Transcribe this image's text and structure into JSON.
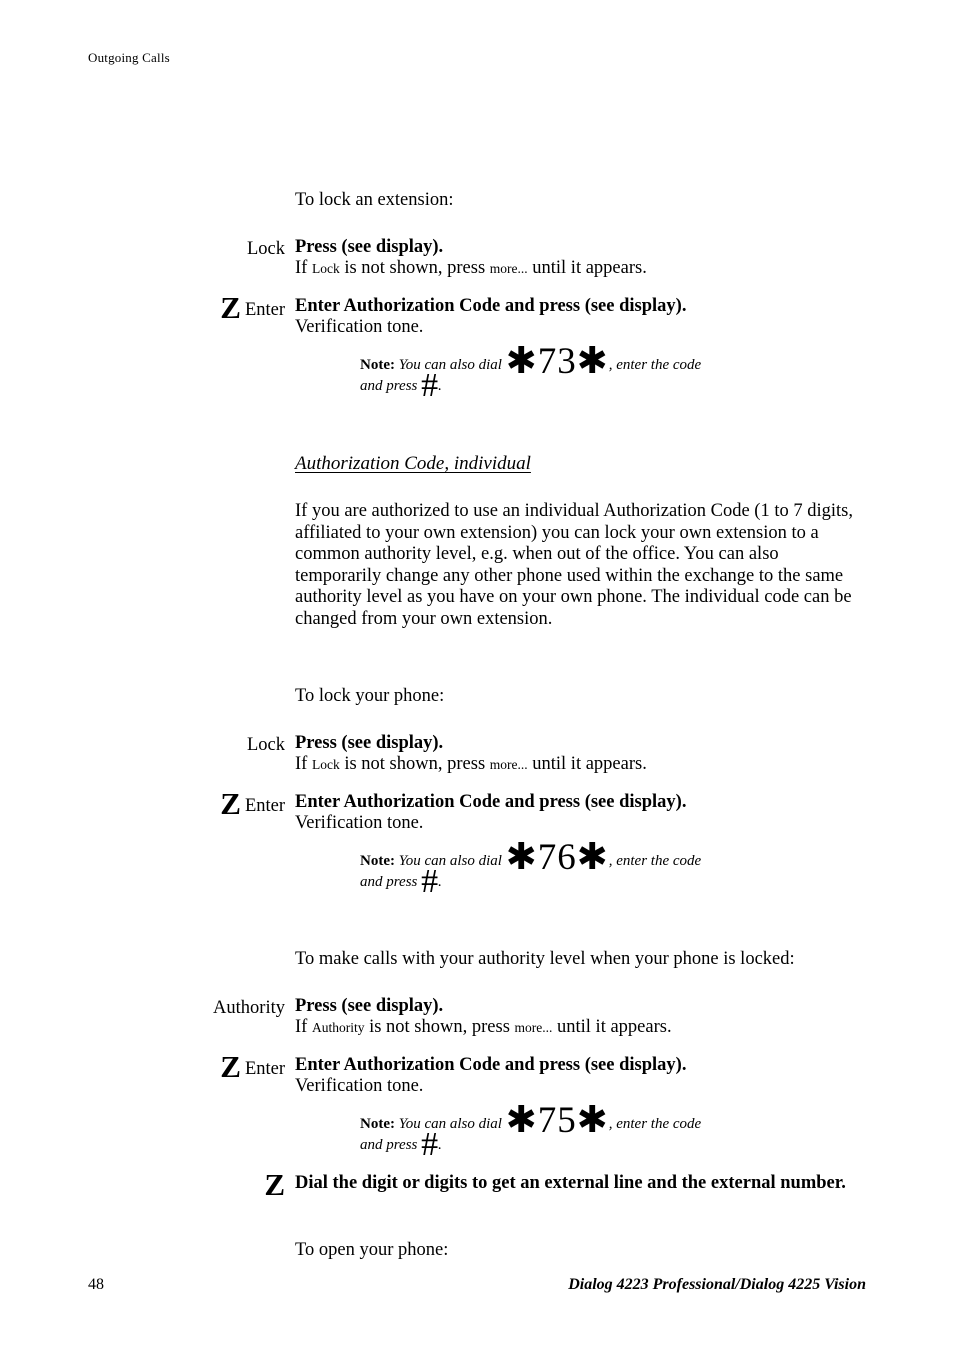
{
  "header": {
    "running_head": "Outgoing Calls"
  },
  "sections": [
    {
      "lead": "To lock an extension:",
      "steps": [
        {
          "key_glyph": "",
          "key_label": "Lock",
          "title": "Press (see display).",
          "sub_prefix": "If ",
          "sub_softkey1": "Lock",
          "sub_middle": " is not shown, press ",
          "sub_softkey2": "more...",
          "sub_suffix": " until it appears."
        },
        {
          "key_glyph": "Z",
          "key_label": "Enter",
          "title": "Enter Authorization Code and press (see display).",
          "sub_plain": "Verification tone."
        }
      ],
      "note": {
        "label": "Note:",
        "text_before": "You can also dial",
        "code": "✱73✱",
        "text_middle": ", enter the code",
        "text_after": "and press",
        "hash": "#",
        "period": "."
      }
    },
    {
      "heading": "Authorization Code, individual",
      "paragraph": "If you are authorized to use an individual Authorization Code (1 to 7 digits, affiliated to your own extension) you can lock your own extension to a common authority level, e.g. when out of the office. You can also temporarily change any other phone used within the exchange to the same authority level as you have on your own phone. The individual code can be changed from your own extension.",
      "lead": "To lock your phone:",
      "steps": [
        {
          "key_glyph": "",
          "key_label": "Lock",
          "title": "Press (see display).",
          "sub_prefix": "If ",
          "sub_softkey1": "Lock",
          "sub_middle": " is not shown, press ",
          "sub_softkey2": "more...",
          "sub_suffix": " until it appears."
        },
        {
          "key_glyph": "Z",
          "key_label": "Enter",
          "title": "Enter Authorization Code and press (see display).",
          "sub_plain": "Verification tone."
        }
      ],
      "note": {
        "label": "Note:",
        "text_before": "You can also dial",
        "code": "✱76✱",
        "text_middle": ", enter the code",
        "text_after": "and press",
        "hash": "#",
        "period": "."
      }
    },
    {
      "lead": "To make calls with your authority level when your phone is locked:",
      "steps": [
        {
          "key_glyph": "",
          "key_label": "Authority",
          "title": "Press (see display).",
          "sub_prefix": "If ",
          "sub_softkey1": "Authority",
          "sub_middle": " is not shown, press ",
          "sub_softkey2": "more...",
          "sub_suffix": " until it appears."
        },
        {
          "key_glyph": "Z",
          "key_label": "Enter",
          "title": "Enter Authorization Code and press (see display).",
          "sub_plain": "Verification tone."
        }
      ],
      "note": {
        "label": "Note:",
        "text_before": "You can also dial",
        "code": "✱75✱",
        "text_middle": ", enter the code",
        "text_after": "and press",
        "hash": "#",
        "period": "."
      },
      "final_step": {
        "key_glyph": "Z",
        "title": "Dial the digit or digits to get an external line and the external number."
      },
      "closing_lead": "To open your phone:"
    }
  ],
  "footer": {
    "page_number": "48",
    "document_title": "Dialog 4223 Professional/Dialog 4225 Vision"
  }
}
